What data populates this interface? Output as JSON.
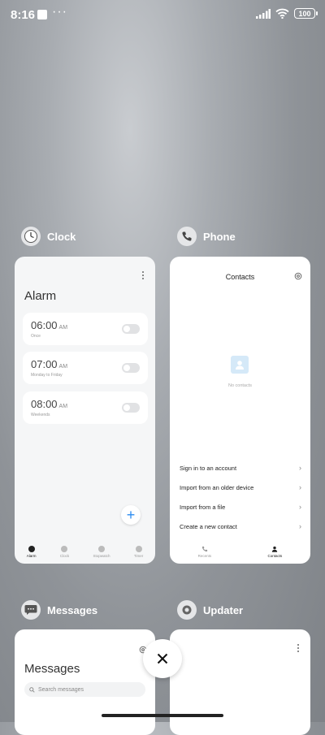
{
  "status_bar": {
    "time": "8:16",
    "dots": "···",
    "battery": "100"
  },
  "apps": {
    "clock": {
      "name": "Clock",
      "title": "Alarm",
      "alarms": [
        {
          "time": "06:00",
          "ampm": "AM",
          "sub": "Once"
        },
        {
          "time": "07:00",
          "ampm": "AM",
          "sub": "Monday to Friday"
        },
        {
          "time": "08:00",
          "ampm": "AM",
          "sub": "Weekends"
        }
      ],
      "nav": [
        "Alarm",
        "Clock",
        "Stopwatch",
        "Timer"
      ]
    },
    "phone": {
      "name": "Phone",
      "title": "Contacts",
      "empty_text": "No contacts",
      "menu": [
        "Sign in to an account",
        "Import from an older device",
        "Import from a file",
        "Create a new contact"
      ],
      "nav": [
        "Recents",
        "Contacts"
      ]
    },
    "messages": {
      "name": "Messages",
      "title": "Messages",
      "search_placeholder": "Search messages"
    },
    "updater": {
      "name": "Updater"
    }
  },
  "colors": {
    "accent": "#2d8cf0",
    "empty_icon": "#d5e9f8"
  }
}
